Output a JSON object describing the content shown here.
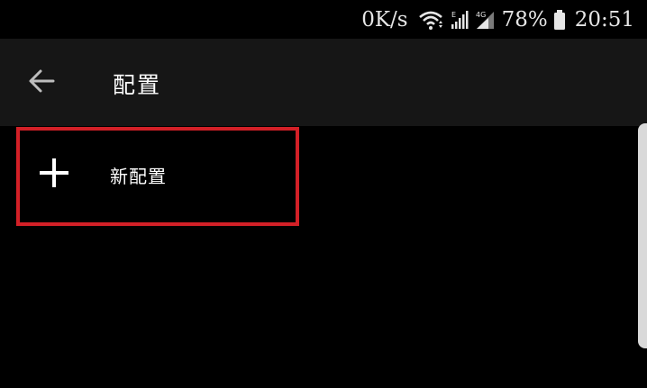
{
  "status_bar": {
    "network_speed": "0K/s",
    "battery_percent": "78%",
    "time": "20:51",
    "icons": [
      "wifi-icon",
      "signal-e-icon",
      "signal-4g-icon",
      "battery-icon"
    ],
    "signal_labels": {
      "e": "E",
      "lte": "4G"
    }
  },
  "app_bar": {
    "back_icon": "arrow-left-icon",
    "title": "配置"
  },
  "list": {
    "items": [
      {
        "icon": "plus-icon",
        "label": "新配置"
      }
    ]
  },
  "colors": {
    "background": "#000000",
    "app_bar": "#161616",
    "highlight": "#d32027",
    "text": "#ffffff"
  }
}
